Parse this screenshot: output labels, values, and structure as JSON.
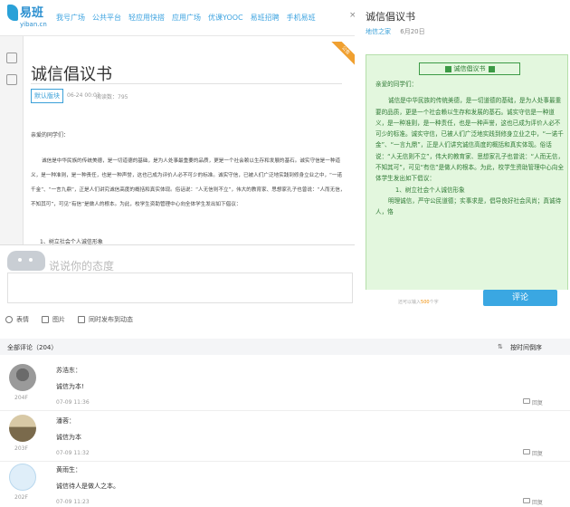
{
  "site": {
    "logo_text": "易班",
    "logo_sub": "yiban.cn",
    "nav": [
      "我号广场",
      "公共平台",
      "轻应用快搭",
      "应用广场",
      "优课YOOC",
      "易班招聘",
      "手机易班"
    ]
  },
  "article": {
    "title": "诚信倡议书",
    "tag": "默认版块",
    "date": "06-24 00:03",
    "views": "阅读数：795",
    "ribbon": "公告",
    "greeting": "亲爱的同学们：",
    "body": "诚信是中华民族的传统美德，是一切道德的基础，是为人处事最重要的品质，更是一个社会赖以生存和发展的基石。诚实守信是一种道义，是一种准则，是一种责任，也是一种声誉，这也已成为评价人必不可少的标准。诚实守信，已被人们广泛地实践到修身立业之中，“一诺千金”、“一言九鼎”，正是人们讲究诚信高度的概括和真实体现。俗话说：“人无信则不立”，伟大的教育家、思想家孔子也曾说：“人而无信，不知其可”，可见“有信”是做人的根本。为此，校学生资助管理中心向全体学生发出如下倡议：",
    "subheading": "1、树立社会个人诚信形象"
  },
  "comment_input": {
    "placeholder": "说说你的态度",
    "limit_prefix": "还可以输入",
    "limit_count": "500",
    "limit_suffix": "个字",
    "submit": "评论",
    "options": [
      "表情",
      "图片",
      "同时发布到动态"
    ]
  },
  "comments_header": {
    "label": "全部评论",
    "count": "（204）",
    "sort": "按时间倒序"
  },
  "comments": [
    {
      "name": "苏浩东：",
      "text": "诚信为本!",
      "time": "07-09 11:36",
      "floor": "204F",
      "reply": "回复"
    },
    {
      "name": "潘蓉：",
      "text": "诚信为本",
      "time": "07-09 11:32",
      "floor": "203F",
      "reply": "回复"
    },
    {
      "name": "黄雨生：",
      "text": "诚信待人是做人之本。",
      "time": "07-09 11:23",
      "floor": "202F",
      "reply": "回复"
    }
  ],
  "right": {
    "title": "诚信倡议书",
    "author": "地信之家",
    "date": "6月20日",
    "doc_header": "诚信倡议书",
    "doc_greeting": "亲爱的同学们：",
    "doc_body": "诚信是中华民族的传统美德，是一切道德的基础，是为人处事最重要的品质，更是一个社会赖以生存和发展的基石。诚实守信是一种道义，是一种准则，是一种责任，也是一种声誉，这也已成为评价人必不可少的标准。诚实守信，已被人们广泛地实践到修身立业之中，“一诺千金”、“一言九鼎”，正是人们讲究诚信高度的概括和真实体现。俗话说：“人无信则不立”，伟大的教育家、思想家孔子也曾说：“人而无信，不知其可”，可见“有信”是做人的根本。为此，校学生资助管理中心向全体学生发出如下倡议：",
    "doc_sub1": "1、树立社会个人诚信形象",
    "doc_sub2": "明理诚信，严守公民道德；实事求是，倡导良好社会风尚；真诚待人，恪"
  },
  "colors": {
    "accent": "#3aa7e2",
    "doc_bg": "#e3f7de",
    "doc_text": "#2f7a35"
  },
  "icons": [
    "close-icon",
    "emoji-icon",
    "image-icon",
    "checkbox-icon",
    "sort-icon",
    "reply-icon"
  ]
}
